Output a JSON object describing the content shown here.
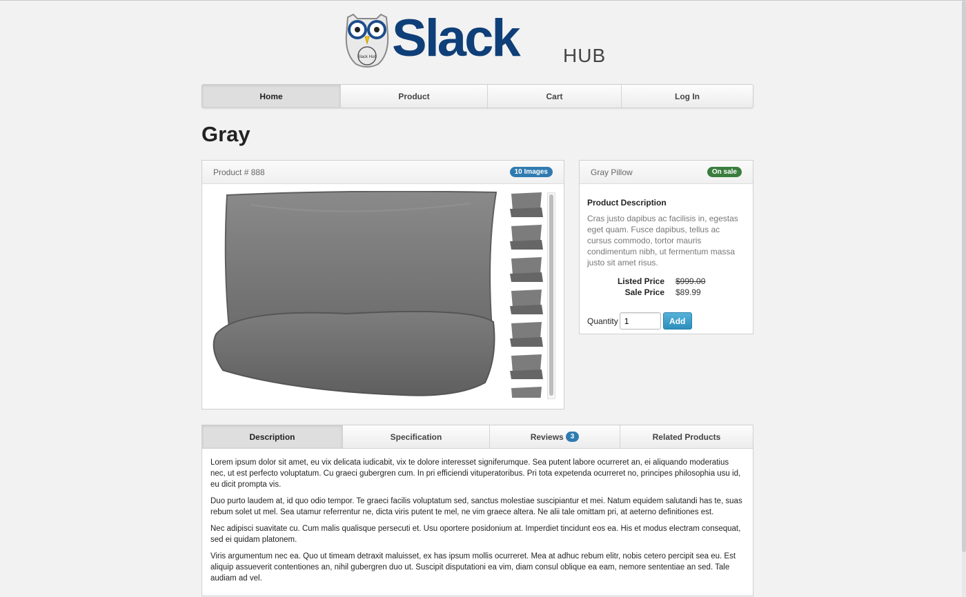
{
  "brand": {
    "name": "Slack",
    "suffix": "HUB",
    "owl_badge": "Slack Hub"
  },
  "nav": {
    "items": [
      {
        "label": "Home",
        "active": true
      },
      {
        "label": "Product",
        "active": false
      },
      {
        "label": "Cart",
        "active": false
      },
      {
        "label": "Log In",
        "active": false
      }
    ]
  },
  "page": {
    "title": "Gray"
  },
  "gallery": {
    "product_number": "Product # 888",
    "images_badge": "10 Images",
    "badge_color": "#2f7bb0"
  },
  "info": {
    "name": "Gray Pillow",
    "status_badge": "On sale",
    "status_color": "#3a7d3e",
    "desc_title": "Product Description",
    "desc_text": "Cras justo dapibus ac facilisis in, egestas eget quam. Fusce dapibus, tellus ac cursus commodo, tortor mauris condimentum nibh, ut fermentum massa justo sit amet risus.",
    "listed_label": "Listed Price",
    "listed_value": "$999.00",
    "sale_label": "Sale Price",
    "sale_value": "$89.99",
    "quantity_label": "Quantity",
    "quantity_value": "1",
    "add_label": "Add"
  },
  "tabs": {
    "items": [
      {
        "label": "Description",
        "active": true
      },
      {
        "label": "Specification",
        "active": false
      },
      {
        "label": "Reviews",
        "count": "3",
        "active": false
      },
      {
        "label": "Related Products",
        "active": false
      }
    ],
    "paragraphs": [
      "Lorem ipsum dolor sit amet, eu vix delicata iudicabit, vix te dolore interesset signiferumque. Sea putent labore ocurreret an, ei aliquando moderatius nec, ut est perfecto voluptatum. Cu graeci gubergren cum. In pri efficiendi vituperatoribus. Pri tota expetenda ocurreret no, principes philosophia usu id, eu dicit prompta vis.",
      "Duo purto laudem at, id quo odio tempor. Te graeci facilis voluptatum sed, sanctus molestiae suscipiantur et mei. Natum equidem salutandi has te, suas rebum solet ut mel. Sea utamur referrentur ne, dicta viris putent te mel, ne vim graece altera. Ne alii tale omittam pri, at aeterno definitiones est.",
      "Nec adipisci suavitate cu. Cum malis qualisque persecuti et. Usu oportere posidonium at. Imperdiet tincidunt eos ea. His et modus electram consequat, sed ei quidam platonem.",
      "Viris argumentum nec ea. Quo ut timeam detraxit maluisset, ex has ipsum mollis ocurreret. Mea at adhuc rebum elitr, nobis cetero percipit sea eu. Est aliquip assueverit contentiones an, nihil gubergren duo ut. Suscipit disputationi ea vim, diam consul oblique ea eam, nemore sententiae an sed. Tale audiam ad vel."
    ]
  }
}
